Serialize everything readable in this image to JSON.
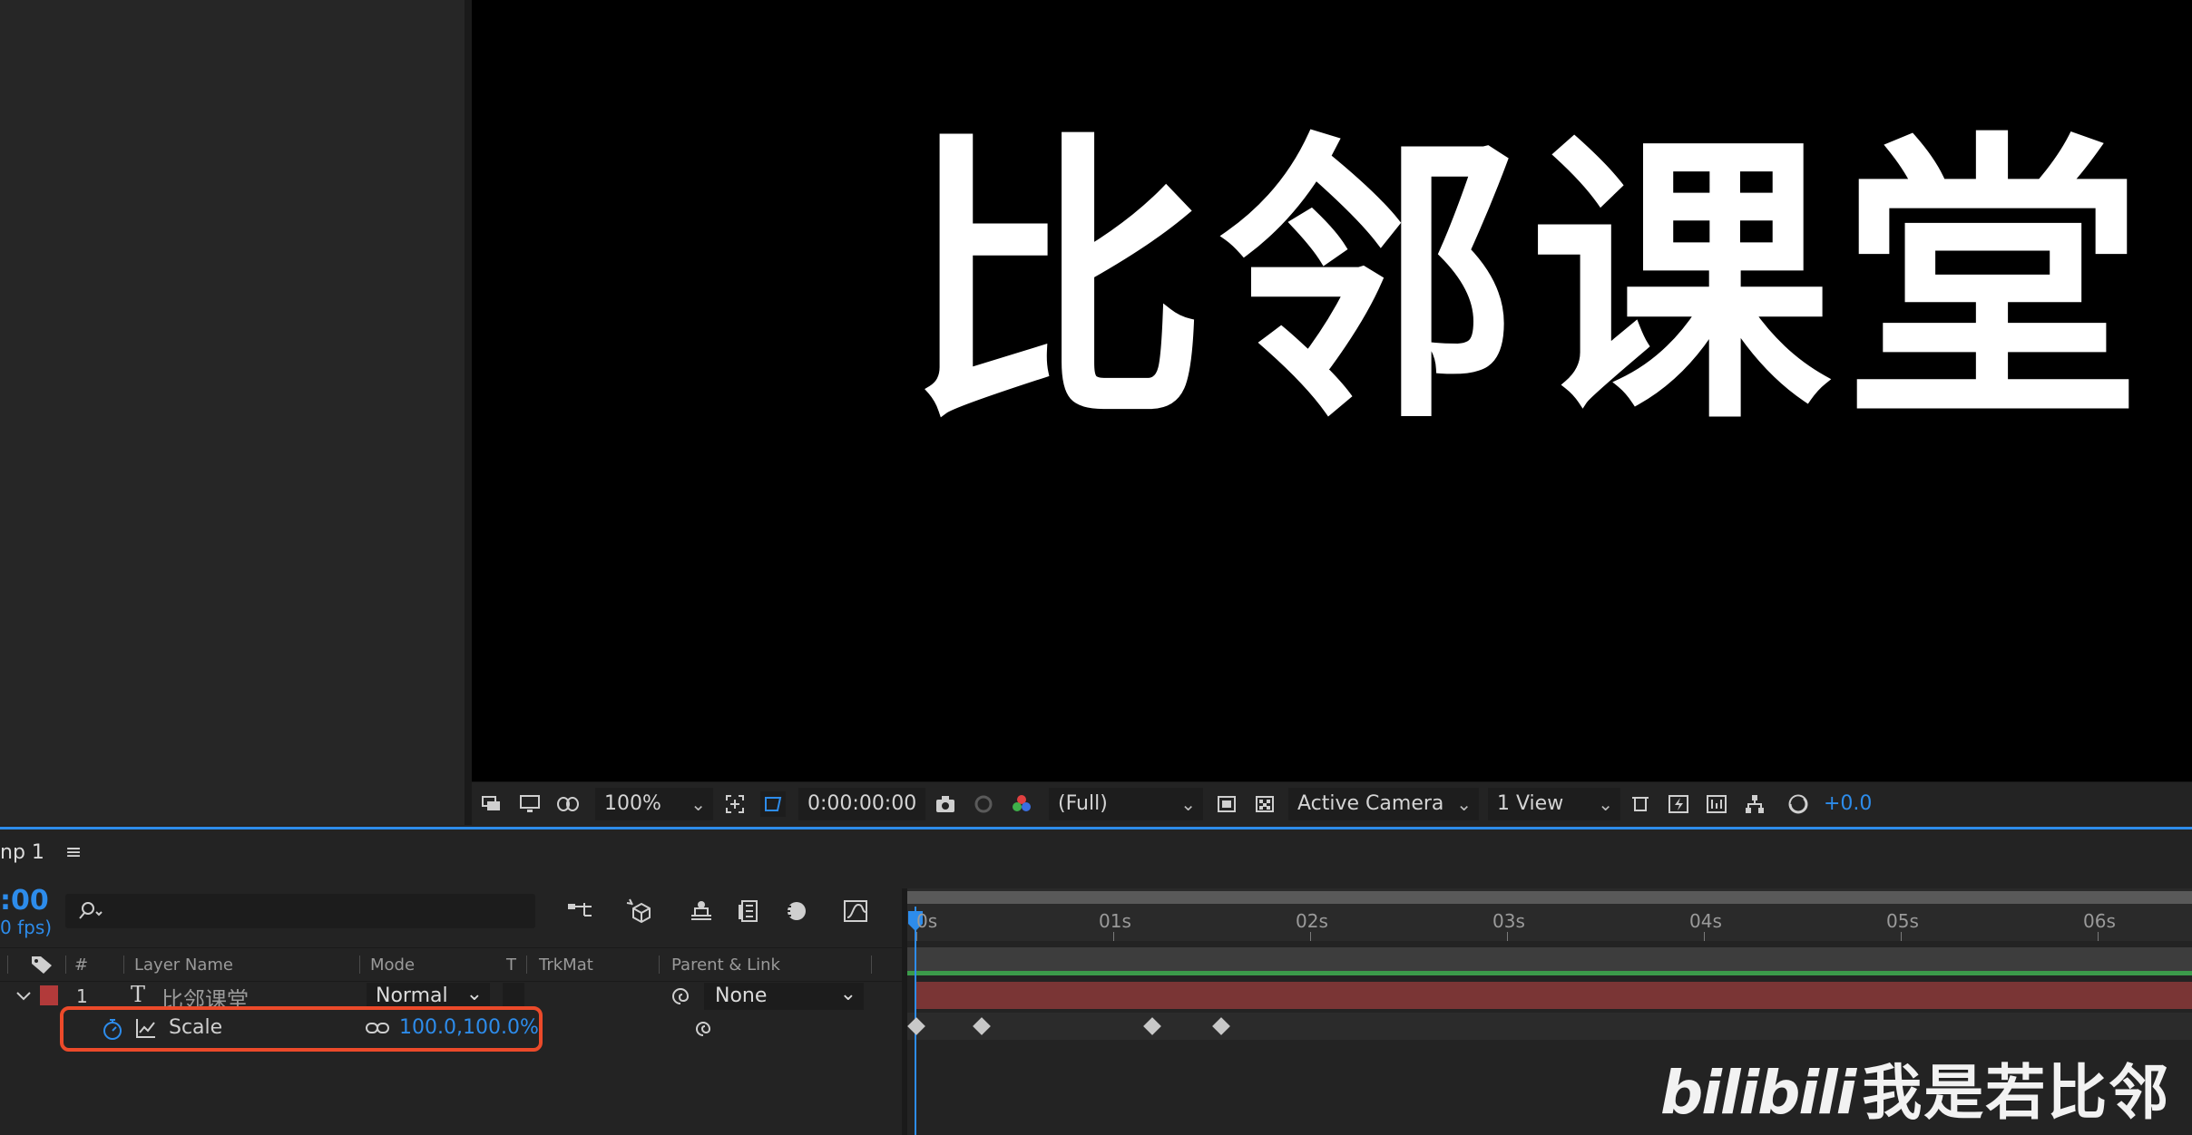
{
  "viewer": {
    "text": "比邻课堂",
    "toolbar": {
      "zoom": "100%",
      "timecode": "0:00:00:00",
      "resolution": "(Full)",
      "camera": "Active Camera",
      "views": "1 View",
      "exposure": "+0.0"
    }
  },
  "timeline": {
    "comp_tab": "np 1",
    "menu_icon": "≡",
    "timecode": ":00",
    "fps": "0 fps)",
    "search_placeholder": "",
    "headers": {
      "num": "#",
      "layer_name": "Layer Name",
      "mode": "Mode",
      "t": "T",
      "trkmat": "TrkMat",
      "parent": "Parent & Link"
    },
    "layer": {
      "number": "1",
      "type_glyph": "T",
      "name": "比邻课堂",
      "mode": "Normal",
      "parent": "None",
      "label_color": "#b23a3a"
    },
    "property": {
      "name": "Scale",
      "value": "100.0,100.0%"
    },
    "ruler": [
      "0s",
      "01s",
      "02s",
      "03s",
      "04s",
      "05s",
      "06s"
    ],
    "keyframe_times_s": [
      0,
      0.33,
      1.2,
      1.55
    ]
  },
  "watermark": "我是若比邻",
  "colors": {
    "accent": "#2d8ceb",
    "highlight": "#ec4a2a",
    "layer_bar": "#7a3535",
    "track_green": "#3b9a4a"
  }
}
